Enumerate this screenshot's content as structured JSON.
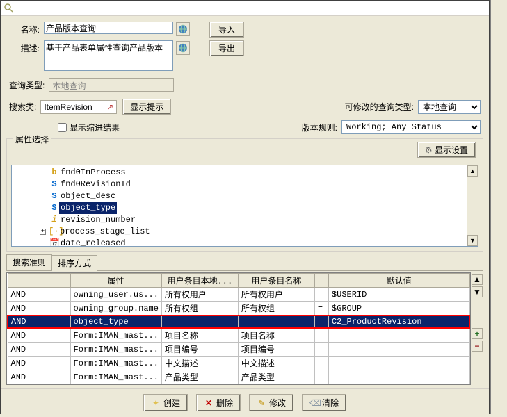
{
  "labels": {
    "name": "名称:",
    "desc": "描述:",
    "queryType": "查询类型:",
    "searchClass": "搜索类:",
    "showHint": "显示提示",
    "showIndent": "显示缩进结果",
    "modifiableType": "可修改的查询类型:",
    "versionRule": "版本规则:",
    "attrSelect": "属性选择",
    "showSettings": "显示设置"
  },
  "name_value": "产品版本查询",
  "desc_value": "基于产品表单属性查询产品版本",
  "import_btn": "导入",
  "export_btn": "导出",
  "queryType_value": "本地查询",
  "searchClass_value": "ItemRevision",
  "modifiableType_value": "本地查询",
  "versionRule_value": "Working; Any Status",
  "tree": {
    "items": [
      {
        "glyph": "b",
        "cls": "g-b",
        "label": "fnd0InProcess"
      },
      {
        "glyph": "S",
        "cls": "g-S",
        "label": "fnd0RevisionId"
      },
      {
        "glyph": "S",
        "cls": "g-S",
        "label": "object_desc"
      },
      {
        "glyph": "S",
        "cls": "g-S",
        "label": "object_type",
        "selected": true
      },
      {
        "glyph": "i",
        "cls": "g-i",
        "label": "revision_number"
      },
      {
        "glyph": "[·]",
        "cls": "g-date",
        "label": "process_stage_list",
        "expander": "+"
      },
      {
        "glyph": "📅",
        "cls": "g-date",
        "label": "date_released"
      }
    ]
  },
  "tabs": {
    "search_rule": "搜索准则",
    "sort": "排序方式"
  },
  "grid": {
    "headers": {
      "c0": "",
      "c1": "属性",
      "c2": "用户条目本地...",
      "c3": "用户条目名称",
      "c4": "",
      "c5": "默认值"
    },
    "rows": [
      {
        "c0": "AND",
        "c1": "owning_user.us...",
        "c2": "所有权用户",
        "c3": "所有权用户",
        "c4": "=",
        "c5": "$USERID"
      },
      {
        "c0": "AND",
        "c1": "owning_group.name",
        "c2": "所有权组",
        "c3": "所有权组",
        "c4": "=",
        "c5": "$GROUP"
      },
      {
        "c0": "AND",
        "c1": "object_type",
        "c2": "",
        "c3": "",
        "c4": "=",
        "c5": "C2_ProductRevision",
        "sel": true,
        "red": true
      },
      {
        "c0": "AND",
        "c1": "Form:IMAN_mast...",
        "c2": "项目名称",
        "c3": "项目名称",
        "c4": "",
        "c5": ""
      },
      {
        "c0": "AND",
        "c1": "Form:IMAN_mast...",
        "c2": "项目编号",
        "c3": "项目编号",
        "c4": "",
        "c5": ""
      },
      {
        "c0": "AND",
        "c1": "Form:IMAN_mast...",
        "c2": "中文描述",
        "c3": "中文描述",
        "c4": "",
        "c5": ""
      },
      {
        "c0": "AND",
        "c1": "Form:IMAN_mast...",
        "c2": "产品类型",
        "c3": "产品类型",
        "c4": "",
        "c5": ""
      }
    ]
  },
  "foot": {
    "create": "创建",
    "delete": "删除",
    "modify": "修改",
    "clear": "清除"
  }
}
